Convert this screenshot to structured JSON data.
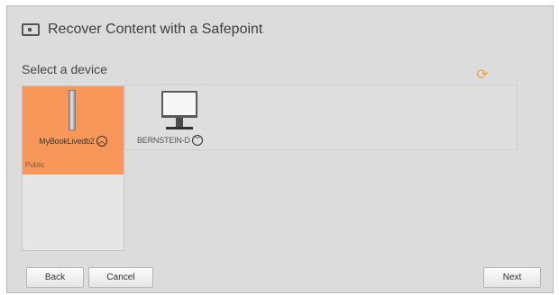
{
  "dialog": {
    "title": "Recover Content with a Safepoint",
    "section_label": "Select a device",
    "accent_color": "#f7985a",
    "refresh_icon": "refresh-icon"
  },
  "devices": [
    {
      "name": "MyBookLivedb2",
      "icon": "nas-drive-icon",
      "selected": true,
      "expand_icon": "chevron-up-icon",
      "share": "Public"
    },
    {
      "name": "BERNSTEIN-D",
      "icon": "monitor-icon",
      "selected": false,
      "expand_icon": "chevron-down-icon"
    }
  ],
  "buttons": {
    "back": "Back",
    "cancel": "Cancel",
    "next": "Next"
  }
}
